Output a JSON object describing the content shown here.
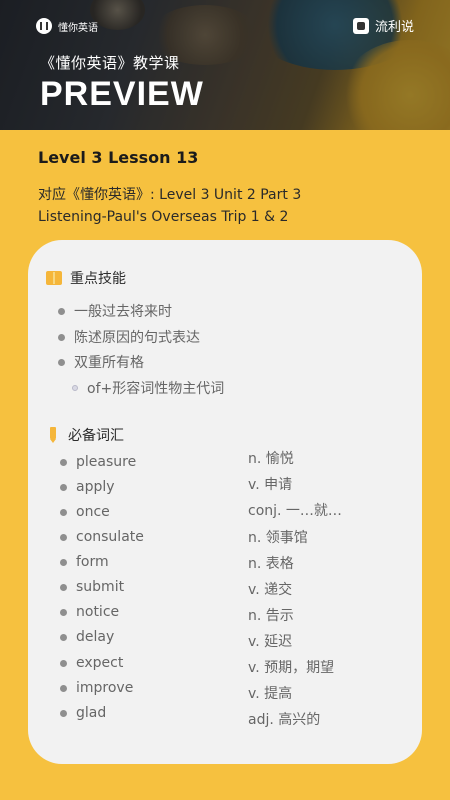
{
  "header": {
    "brand_left": "懂你英语",
    "brand_right": "流利说",
    "subtitle": "《懂你英语》教学课",
    "title": "PREVIEW"
  },
  "lesson": {
    "title": "Level 3 Lesson 13",
    "line1": "对应《懂你英语》: Level 3 Unit 2 Part 3",
    "line2": "Listening-Paul's Overseas Trip 1 & 2"
  },
  "skills": {
    "heading": "重点技能",
    "items": [
      "一般过去将来时",
      "陈述原因的句式表达",
      "双重所有格"
    ],
    "subitem": "of+形容词性物主代词"
  },
  "vocab": {
    "heading": "必备词汇",
    "words": [
      "pleasure",
      "apply",
      "once",
      "consulate",
      "form",
      "submit",
      "notice",
      "delay",
      "expect",
      "improve",
      "glad"
    ],
    "meanings": [
      "n. 愉悦",
      "v. 申请",
      "conj. 一…就…",
      "n. 领事馆",
      "n. 表格",
      "v. 递交",
      "n. 告示",
      "v. 延迟",
      "v. 预期，期望",
      "v. 提高",
      "adj. 高兴的"
    ]
  }
}
